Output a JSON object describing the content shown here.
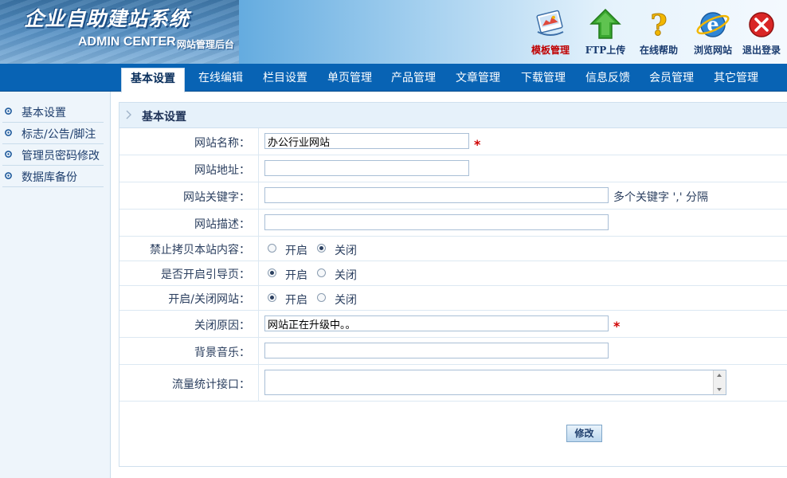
{
  "header": {
    "logo_cn": "企业自助建站系统",
    "logo_en": "ADMIN CENTER",
    "logo_sub": "网站管理后台",
    "tools": [
      {
        "label": "模板管理",
        "icon": "template-icon",
        "highlight": true
      },
      {
        "label": "FTP上传",
        "icon": "upload-arrow-icon",
        "highlight": false
      },
      {
        "label": "在线帮助",
        "icon": "help-question-icon",
        "highlight": false
      },
      {
        "label": "浏览网站",
        "icon": "browser-e-icon",
        "highlight": false
      },
      {
        "label": "退出登录",
        "icon": "logout-x-icon",
        "highlight": false
      }
    ]
  },
  "nav": {
    "tabs": [
      "基本设置",
      "在线编辑",
      "栏目设置",
      "单页管理",
      "产品管理",
      "文章管理",
      "下载管理",
      "信息反馈",
      "会员管理",
      "其它管理"
    ],
    "active_index": 0
  },
  "sidebar": {
    "items": [
      "基本设置",
      "标志/公告/脚注",
      "管理员密码修改",
      "数据库备份"
    ]
  },
  "panel": {
    "title": "基本设置",
    "fields": {
      "site_name": {
        "label": "网站名称：",
        "value": "办公行业网站",
        "required_mark": "*"
      },
      "site_url": {
        "label": "网站地址：",
        "value": ""
      },
      "keywords": {
        "label": "网站关键字：",
        "value": "",
        "hint": "多个关键字 ',' 分隔"
      },
      "description": {
        "label": "网站描述：",
        "value": ""
      },
      "no_copy": {
        "label": "禁止拷贝本站内容：",
        "options": [
          "开启",
          "关闭"
        ],
        "selected": 1
      },
      "guide_page": {
        "label": "是否开启引导页：",
        "options": [
          "开启",
          "关闭"
        ],
        "selected": 0
      },
      "site_open": {
        "label": "开启/关闭网站：",
        "options": [
          "开启",
          "关闭"
        ],
        "selected": 0
      },
      "close_reason": {
        "label": "关闭原因：",
        "value": "网站正在升级中。。",
        "required_mark": "*"
      },
      "bg_music": {
        "label": "背景音乐：",
        "value": ""
      },
      "stats_code": {
        "label": "流量统计接口：",
        "value": ""
      }
    },
    "submit_label": "修改"
  },
  "colors": {
    "nav_bg": "#0863b4",
    "sidebar_bg": "#eef5fb",
    "panel_head_bg": "#e6f1fa",
    "required": "#d00000",
    "tool_highlight": "#c00000"
  }
}
